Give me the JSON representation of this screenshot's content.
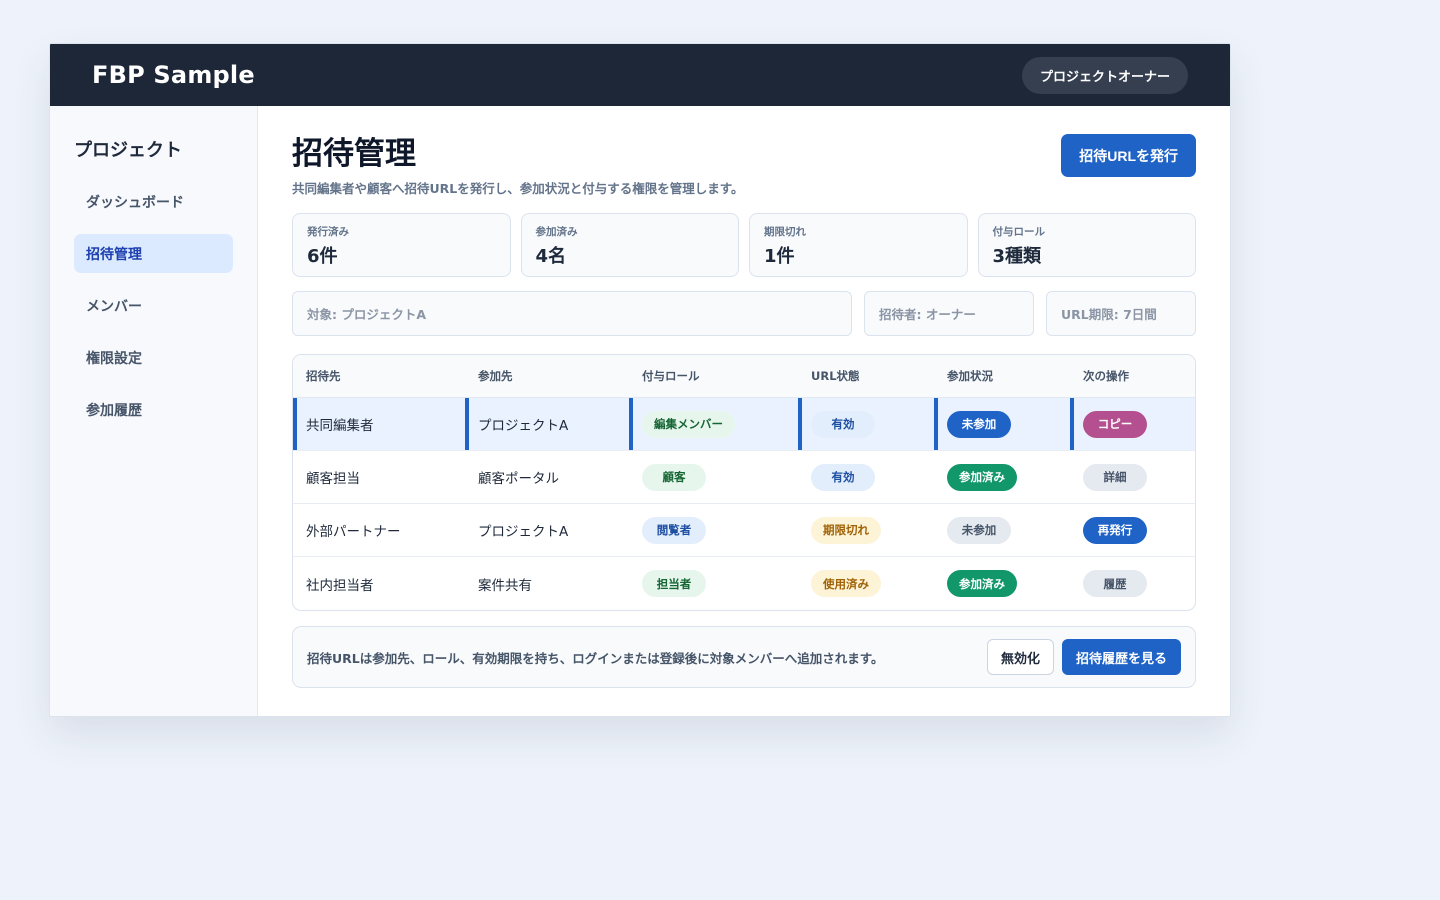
{
  "app": {
    "brand": "FBP Sample",
    "user_role": "プロジェクトオーナー"
  },
  "sidebar": {
    "title": "プロジェクト",
    "items": [
      {
        "label": "ダッシュボード",
        "active": false
      },
      {
        "label": "招待管理",
        "active": true
      },
      {
        "label": "メンバー",
        "active": false
      },
      {
        "label": "権限設定",
        "active": false
      },
      {
        "label": "参加履歴",
        "active": false
      }
    ]
  },
  "page": {
    "title": "招待管理",
    "description": "共同編集者や顧客へ招待URLを発行し、参加状況と付与する権限を管理します。",
    "primary_action": "招待URLを発行"
  },
  "stats": [
    {
      "label": "発行済み",
      "value": "6件"
    },
    {
      "label": "参加済み",
      "value": "4名"
    },
    {
      "label": "期限切れ",
      "value": "1件"
    },
    {
      "label": "付与ロール",
      "value": "3種類"
    }
  ],
  "filters": {
    "target": "対象: プロジェクトA",
    "inviter": "招待者: オーナー",
    "expiry": "URL期限: 7日間"
  },
  "table": {
    "headers": [
      "招待先",
      "参加先",
      "付与ロール",
      "URL状態",
      "参加状況",
      "次の操作"
    ],
    "rows": [
      {
        "invitee": "共同編集者",
        "destination": "プロジェクトA",
        "role": "編集メンバー",
        "url_status": "有効",
        "participation": "未参加",
        "action": "コピー",
        "selected": true
      },
      {
        "invitee": "顧客担当",
        "destination": "顧客ポータル",
        "role": "顧客",
        "url_status": "有効",
        "participation": "参加済み",
        "action": "詳細",
        "selected": false
      },
      {
        "invitee": "外部パートナー",
        "destination": "プロジェクトA",
        "role": "閲覧者",
        "url_status": "期限切れ",
        "participation": "未参加",
        "action": "再発行",
        "selected": false
      },
      {
        "invitee": "社内担当者",
        "destination": "案件共有",
        "role": "担当者",
        "url_status": "使用済み",
        "participation": "参加済み",
        "action": "履歴",
        "selected": false
      }
    ]
  },
  "footer": {
    "note": "招待URLは参加先、ロール、有効期限を持ち、ログインまたは登録後に対象メンバーへ追加されます。",
    "disable_label": "無効化",
    "history_label": "招待履歴を見る"
  },
  "colors": {
    "topbar": "#1e2737",
    "primary": "#1f63c6",
    "active_nav_bg": "#dbeafe",
    "selected_row_bg": "#eaf2ff"
  }
}
